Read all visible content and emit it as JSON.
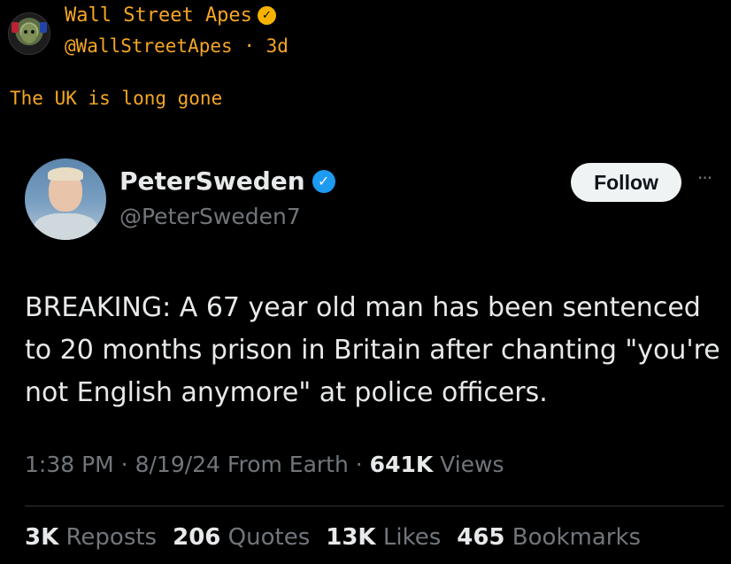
{
  "outer_tweet": {
    "name": "Wall Street Apes",
    "handle": "@WallStreetApes",
    "separator": "·",
    "time": "3d",
    "text": "The UK is long gone",
    "badge_color": "#f5b300",
    "name_color": "#f5a623"
  },
  "quoted_tweet": {
    "name": "PeterSweden",
    "handle": "@PeterSweden7",
    "follow_label": "Follow",
    "more_label": "···",
    "text": "BREAKING: A 67 year old man has been sentenced to 20 months prison in Britain after chanting \"you're not English anymore\" at police officers.",
    "meta": {
      "time": "1:38 PM",
      "sep1": " · ",
      "date": "8/19/24",
      "source": " From Earth",
      "sep2": " · ",
      "views_count": "641K",
      "views_label": " Views"
    },
    "stats": [
      {
        "count": "3K",
        "label": " Reposts"
      },
      {
        "count": "206",
        "label": " Quotes"
      },
      {
        "count": "13K",
        "label": " Likes"
      },
      {
        "count": "465",
        "label": " Bookmarks"
      }
    ],
    "badge_color": "#1d9bf0",
    "verified_glyph": "✓"
  },
  "icons": {
    "outer_badge": "verified-gold-icon",
    "inner_badge": "verified-blue-icon",
    "more": "more-horizontal-icon"
  }
}
